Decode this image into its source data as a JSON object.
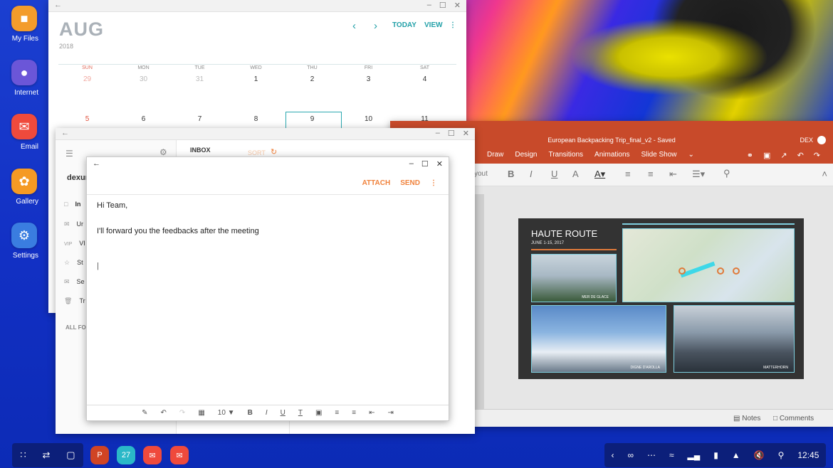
{
  "dock": {
    "apps": [
      {
        "label": "My Files",
        "icon": "folder-icon",
        "color": "#f39c2b"
      },
      {
        "label": "Internet",
        "icon": "planet-icon",
        "color": "#6b56d8"
      },
      {
        "label": "Email",
        "icon": "envelope-icon",
        "color": "#ef4a3c"
      },
      {
        "label": "Gallery",
        "icon": "flower-icon",
        "color": "#f59a24"
      },
      {
        "label": "Settings",
        "icon": "gear-icon",
        "color": "#3a7de0"
      }
    ]
  },
  "calendar": {
    "month": "AUG",
    "year": "2018",
    "today_label": "TODAY",
    "view_label": "VIEW",
    "days_of_week": [
      "SUN",
      "MON",
      "TUE",
      "WED",
      "THU",
      "FRI",
      "SAT"
    ],
    "week1": [
      "29",
      "30",
      "31",
      "1",
      "2",
      "3",
      "4"
    ],
    "week2": [
      "5",
      "6",
      "7",
      "8",
      "9",
      "10",
      "11"
    ]
  },
  "email": {
    "inbox_label": "INBOX",
    "sort_label": "SORT",
    "account": "dexun",
    "folders": [
      "In",
      "Ur",
      "VI",
      "St",
      "Se",
      "Tr"
    ],
    "all_folders": "ALL FOL"
  },
  "compose": {
    "attach_label": "ATTACH",
    "send_label": "SEND",
    "greeting": "Hi Team,",
    "body": "I'll forward you the feedbacks after the meeting",
    "font_size": "10"
  },
  "powerpoint": {
    "title": "European Backpacking Trip_final_v2 - Saved",
    "user": "DEX",
    "tabs": [
      "Draw",
      "Design",
      "Transitions",
      "Animations",
      "Slide Show"
    ],
    "ribbon_partial": "yout",
    "slide": {
      "title": "HAUTE ROUTE",
      "date": "JUNE 1-15, 2017",
      "captions": [
        "MER DE GLACE",
        "DIGNE D'AROLLA",
        "MATTERHORN"
      ]
    },
    "notes_label": "Notes",
    "comments_label": "Comments"
  },
  "taskbar": {
    "calendar_badge": "27",
    "time": "12:45"
  }
}
